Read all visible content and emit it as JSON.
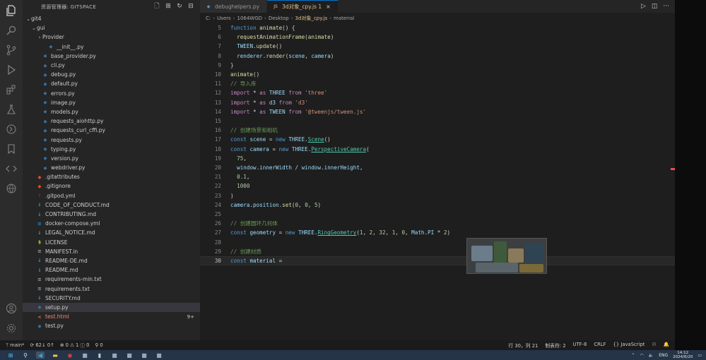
{
  "sidebar": {
    "title": "资源管理器: GITSPACE",
    "tree": [
      {
        "label": "git4",
        "depth": 0,
        "kind": "folder-open",
        "icon": "chevron-down-icon"
      },
      {
        "label": "gui",
        "depth": 1,
        "kind": "folder-open",
        "icon": "chevron-down-icon"
      },
      {
        "label": "Provider",
        "depth": 2,
        "kind": "folder",
        "icon": "chevron-right-icon"
      },
      {
        "label": "__init__.py",
        "depth": 3,
        "kind": "file",
        "icon": "python-file-icon"
      },
      {
        "label": "base_provider.py",
        "depth": 2,
        "kind": "file",
        "icon": "python-file-icon"
      },
      {
        "label": "cli.py",
        "depth": 2,
        "kind": "file",
        "icon": "python-file-icon"
      },
      {
        "label": "debug.py",
        "depth": 2,
        "kind": "file",
        "icon": "python-file-icon"
      },
      {
        "label": "default.py",
        "depth": 2,
        "kind": "file",
        "icon": "python-file-icon"
      },
      {
        "label": "errors.py",
        "depth": 2,
        "kind": "file",
        "icon": "python-file-icon"
      },
      {
        "label": "image.py",
        "depth": 2,
        "kind": "file",
        "icon": "python-file-icon"
      },
      {
        "label": "models.py",
        "depth": 2,
        "kind": "file",
        "icon": "python-file-icon"
      },
      {
        "label": "requests_aiohttp.py",
        "depth": 2,
        "kind": "file",
        "icon": "python-file-icon"
      },
      {
        "label": "requests_curl_cffi.py",
        "depth": 2,
        "kind": "file",
        "icon": "python-file-icon"
      },
      {
        "label": "requests.py",
        "depth": 2,
        "kind": "file",
        "icon": "python-file-icon"
      },
      {
        "label": "typing.py",
        "depth": 2,
        "kind": "file",
        "icon": "python-file-icon"
      },
      {
        "label": "version.py",
        "depth": 2,
        "kind": "file",
        "icon": "python-file-icon"
      },
      {
        "label": "webdriver.py",
        "depth": 2,
        "kind": "file",
        "icon": "python-file-icon"
      },
      {
        "label": ".gitattributes",
        "depth": 1,
        "kind": "file",
        "icon": "git-file-icon"
      },
      {
        "label": ".gitignore",
        "depth": 1,
        "kind": "file",
        "icon": "git-file-icon"
      },
      {
        "label": ".gitpod.yml",
        "depth": 1,
        "kind": "file",
        "icon": "yaml-file-icon"
      },
      {
        "label": "CODE_OF_CONDUCT.md",
        "depth": 1,
        "kind": "file",
        "icon": "markdown-file-icon"
      },
      {
        "label": "CONTRIBUTING.md",
        "depth": 1,
        "kind": "file",
        "icon": "markdown-file-icon"
      },
      {
        "label": "docker-compose.yml",
        "depth": 1,
        "kind": "file",
        "icon": "docker-file-icon"
      },
      {
        "label": "LEGAL_NOTICE.md",
        "depth": 1,
        "kind": "file",
        "icon": "markdown-file-icon"
      },
      {
        "label": "LICENSE",
        "depth": 1,
        "kind": "file",
        "icon": "license-file-icon"
      },
      {
        "label": "MANIFEST.in",
        "depth": 1,
        "kind": "file",
        "icon": "text-file-icon"
      },
      {
        "label": "README-DE.md",
        "depth": 1,
        "kind": "file",
        "icon": "markdown-file-icon"
      },
      {
        "label": "README.md",
        "depth": 1,
        "kind": "file",
        "icon": "info-file-icon"
      },
      {
        "label": "requirements-min.txt",
        "depth": 1,
        "kind": "file",
        "icon": "text-file-icon"
      },
      {
        "label": "requirements.txt",
        "depth": 1,
        "kind": "file",
        "icon": "text-file-icon"
      },
      {
        "label": "SECURITY.md",
        "depth": 1,
        "kind": "file",
        "icon": "markdown-file-icon"
      },
      {
        "label": "setup.py",
        "depth": 1,
        "kind": "file",
        "icon": "python-file-icon",
        "selected": true
      },
      {
        "label": "test.html",
        "depth": 1,
        "kind": "file",
        "icon": "html-file-icon",
        "state": "error",
        "badge": "9+"
      },
      {
        "label": "test.py",
        "depth": 1,
        "kind": "file",
        "icon": "python-file-icon"
      }
    ]
  },
  "tabs": [
    {
      "label": "debughelpers.py",
      "icon": "python-file-icon",
      "active": false
    },
    {
      "label": "3d对象_cpy.js 1",
      "icon": "javascript-file-icon",
      "active": true
    }
  ],
  "breadcrumb": [
    "C:",
    "Users",
    "1064WGD",
    "Desktop",
    "3d对象_cpy.js",
    "material"
  ],
  "code": [
    {
      "n": "5",
      "t": [
        [
          "kw2",
          "function "
        ],
        [
          "fn",
          "animate"
        ],
        [
          "pl",
          "() {"
        ]
      ]
    },
    {
      "n": "6",
      "t": [
        [
          "pl",
          "  "
        ],
        [
          "fn",
          "requestAnimationFrame"
        ],
        [
          "pl",
          "("
        ],
        [
          "fn",
          "animate"
        ],
        [
          "pl",
          ")"
        ]
      ]
    },
    {
      "n": "7",
      "t": [
        [
          "pl",
          "  "
        ],
        [
          "var",
          "TWEEN"
        ],
        [
          "pl",
          "."
        ],
        [
          "fn",
          "update"
        ],
        [
          "pl",
          "()"
        ]
      ]
    },
    {
      "n": "8",
      "t": [
        [
          "pl",
          "  "
        ],
        [
          "var",
          "renderer"
        ],
        [
          "pl",
          "."
        ],
        [
          "fn",
          "render"
        ],
        [
          "pl",
          "("
        ],
        [
          "var",
          "scene"
        ],
        [
          "pl",
          ", "
        ],
        [
          "var",
          "camera"
        ],
        [
          "pl",
          ")"
        ]
      ]
    },
    {
      "n": "9",
      "t": [
        [
          "pl",
          "}"
        ]
      ]
    },
    {
      "n": "10",
      "t": [
        [
          "fn",
          "animate"
        ],
        [
          "pl",
          "()"
        ]
      ]
    },
    {
      "n": "11",
      "t": [
        [
          "cm",
          "// 导入库"
        ]
      ]
    },
    {
      "n": "12",
      "t": [
        [
          "kw",
          "import "
        ],
        [
          "pl",
          "* "
        ],
        [
          "kw",
          "as "
        ],
        [
          "var",
          "THREE "
        ],
        [
          "kw",
          "from "
        ],
        [
          "str",
          "'three'"
        ]
      ]
    },
    {
      "n": "13",
      "t": [
        [
          "kw",
          "import "
        ],
        [
          "pl",
          "* "
        ],
        [
          "kw",
          "as "
        ],
        [
          "var",
          "d3 "
        ],
        [
          "kw",
          "from "
        ],
        [
          "str",
          "'d3'"
        ]
      ]
    },
    {
      "n": "14",
      "t": [
        [
          "kw",
          "import "
        ],
        [
          "pl",
          "* "
        ],
        [
          "kw",
          "as "
        ],
        [
          "var",
          "TWEEN "
        ],
        [
          "kw",
          "from "
        ],
        [
          "str",
          "'@tweenjs/tween.js'"
        ]
      ]
    },
    {
      "n": "15",
      "t": []
    },
    {
      "n": "16",
      "t": [
        [
          "cm",
          "// 创建场景和相机"
        ]
      ]
    },
    {
      "n": "17",
      "t": [
        [
          "kw2",
          "const "
        ],
        [
          "var",
          "scene"
        ],
        [
          "pl",
          " = "
        ],
        [
          "kw2",
          "new "
        ],
        [
          "var",
          "THREE"
        ],
        [
          "pl",
          "."
        ],
        [
          "cls",
          "Scene"
        ],
        [
          "pl",
          "()"
        ]
      ]
    },
    {
      "n": "18",
      "t": [
        [
          "kw2",
          "const "
        ],
        [
          "var",
          "camera"
        ],
        [
          "pl",
          " = "
        ],
        [
          "kw2",
          "new "
        ],
        [
          "var",
          "THREE"
        ],
        [
          "pl",
          "."
        ],
        [
          "cls",
          "PerspectiveCamera"
        ],
        [
          "pl",
          "("
        ]
      ]
    },
    {
      "n": "19",
      "t": [
        [
          "pl",
          "  "
        ],
        [
          "num",
          "75"
        ],
        [
          "pl",
          ","
        ]
      ]
    },
    {
      "n": "20",
      "t": [
        [
          "pl",
          "  "
        ],
        [
          "var",
          "window"
        ],
        [
          "pl",
          "."
        ],
        [
          "var",
          "innerWidth"
        ],
        [
          "pl",
          " / "
        ],
        [
          "var",
          "window"
        ],
        [
          "pl",
          "."
        ],
        [
          "var",
          "innerHeight"
        ],
        [
          "pl",
          ","
        ]
      ]
    },
    {
      "n": "21",
      "t": [
        [
          "pl",
          "  "
        ],
        [
          "num",
          "0.1"
        ],
        [
          "pl",
          ","
        ]
      ]
    },
    {
      "n": "22",
      "t": [
        [
          "pl",
          "  "
        ],
        [
          "num",
          "1000"
        ]
      ]
    },
    {
      "n": "23",
      "t": [
        [
          "pl",
          ")"
        ]
      ]
    },
    {
      "n": "24",
      "t": [
        [
          "var",
          "camera"
        ],
        [
          "pl",
          "."
        ],
        [
          "var",
          "position"
        ],
        [
          "pl",
          "."
        ],
        [
          "fn",
          "set"
        ],
        [
          "pl",
          "("
        ],
        [
          "num",
          "0"
        ],
        [
          "pl",
          ", "
        ],
        [
          "num",
          "0"
        ],
        [
          "pl",
          ", "
        ],
        [
          "num",
          "5"
        ],
        [
          "pl",
          ")"
        ]
      ]
    },
    {
      "n": "25",
      "t": []
    },
    {
      "n": "26",
      "t": [
        [
          "cm",
          "// 创建圆环几何体"
        ]
      ]
    },
    {
      "n": "27",
      "t": [
        [
          "kw2",
          "const "
        ],
        [
          "var",
          "geometry"
        ],
        [
          "pl",
          " = "
        ],
        [
          "kw2",
          "new "
        ],
        [
          "var",
          "THREE"
        ],
        [
          "pl",
          "."
        ],
        [
          "cls",
          "RingGeometry"
        ],
        [
          "pl",
          "("
        ],
        [
          "num",
          "1"
        ],
        [
          "pl",
          ", "
        ],
        [
          "num",
          "2"
        ],
        [
          "pl",
          ", "
        ],
        [
          "num",
          "32"
        ],
        [
          "pl",
          ", "
        ],
        [
          "num",
          "1"
        ],
        [
          "pl",
          ", "
        ],
        [
          "num",
          "0"
        ],
        [
          "pl",
          ", "
        ],
        [
          "var",
          "Math"
        ],
        [
          "pl",
          "."
        ],
        [
          "var",
          "PI"
        ],
        [
          "pl",
          " * "
        ],
        [
          "num",
          "2"
        ],
        [
          "pl",
          ")"
        ]
      ]
    },
    {
      "n": "28",
      "t": []
    },
    {
      "n": "29",
      "t": [
        [
          "cm",
          "// 创建材质"
        ]
      ]
    },
    {
      "n": "30",
      "t": [
        [
          "kw2",
          "const "
        ],
        [
          "var",
          "material"
        ],
        [
          "pl",
          " ="
        ]
      ],
      "current": true
    }
  ],
  "status": {
    "branch": "main*",
    "sync": "⟳ 62↓ 0↑",
    "errors": "0",
    "warnings": "1",
    "infos": "0",
    "ports": "0",
    "position": "行 30，列 21",
    "spaces": "制表符: 2",
    "encoding": "UTF-8",
    "eol": "CRLF",
    "language": "JavaScript"
  },
  "taskbar": {
    "apps": [
      "windows-start-icon",
      "search-icon",
      "vscode-icon",
      "file-explorer-icon",
      "chrome-icon",
      "app-icon",
      "terminal-icon",
      "app-icon",
      "app-icon",
      "app-icon",
      "app-icon"
    ],
    "ime": "ENG",
    "time": "14:12",
    "date": "2024/6/20"
  },
  "colors": {
    "accent": "#0078d4",
    "modified": "#e2c08d",
    "error": "#f48771",
    "taskbar": "#253447"
  }
}
